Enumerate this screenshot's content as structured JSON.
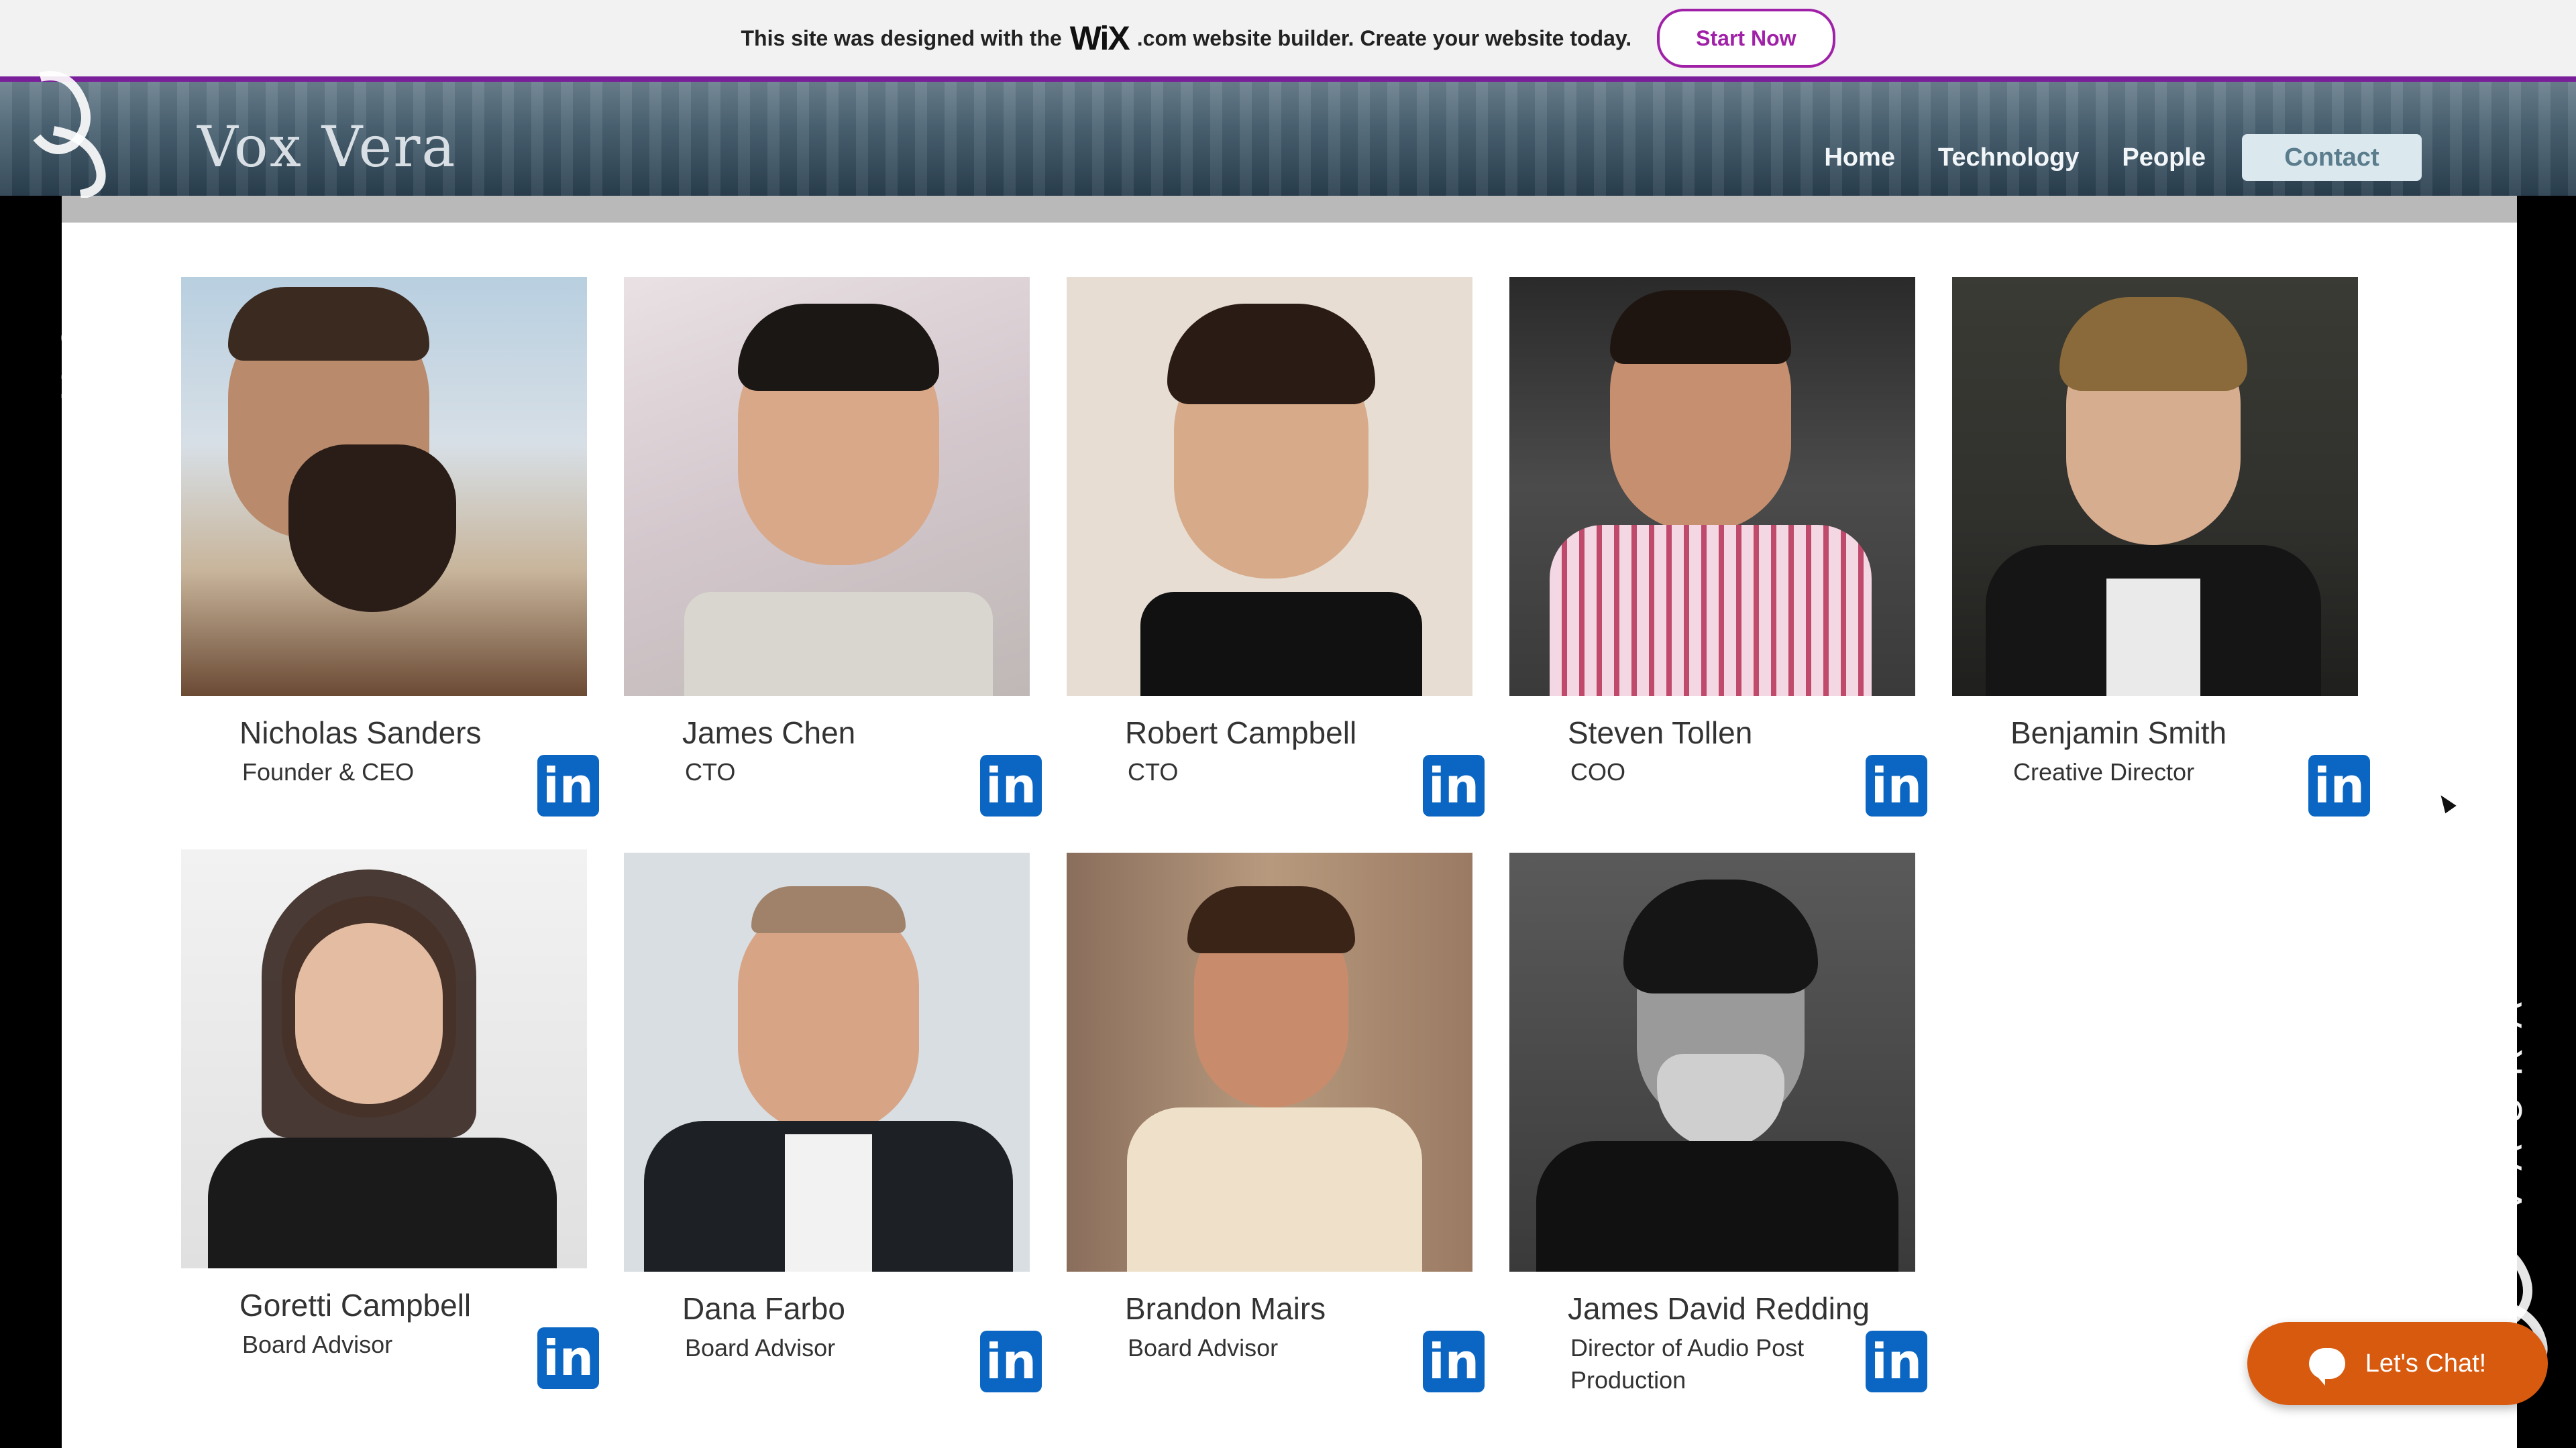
{
  "wix_banner": {
    "text_before": "This site was designed with the",
    "logo": "WiX",
    "text_after": ".com website builder. Create your website today.",
    "button": "Start Now"
  },
  "site": {
    "brand": "Vox Vera",
    "nav": [
      "Home",
      "Technology",
      "People",
      "Contact"
    ]
  },
  "watermark": {
    "text": "VAURA"
  },
  "people": [
    {
      "name": "Nicholas Sanders",
      "role": "Founder & CEO"
    },
    {
      "name": "James Chen",
      "role": "CTO"
    },
    {
      "name": "Robert Campbell",
      "role": "CTO"
    },
    {
      "name": "Steven Tollen",
      "role": "COO"
    },
    {
      "name": "Benjamin Smith",
      "role": "Creative Director"
    },
    {
      "name": "Goretti Campbell",
      "role": "Board Advisor"
    },
    {
      "name": "Dana Farbo",
      "role": "Board Advisor"
    },
    {
      "name": "Brandon Mairs",
      "role": "Board Advisor"
    },
    {
      "name": "James David Redding",
      "role": "Director of Audio Post Production"
    }
  ],
  "linkedin_label": "in",
  "chat": {
    "label": "Let's Chat!"
  },
  "colors": {
    "accent": "#7a1f9a",
    "linkedin": "#0a66c2",
    "chat": "#d85a0f"
  }
}
